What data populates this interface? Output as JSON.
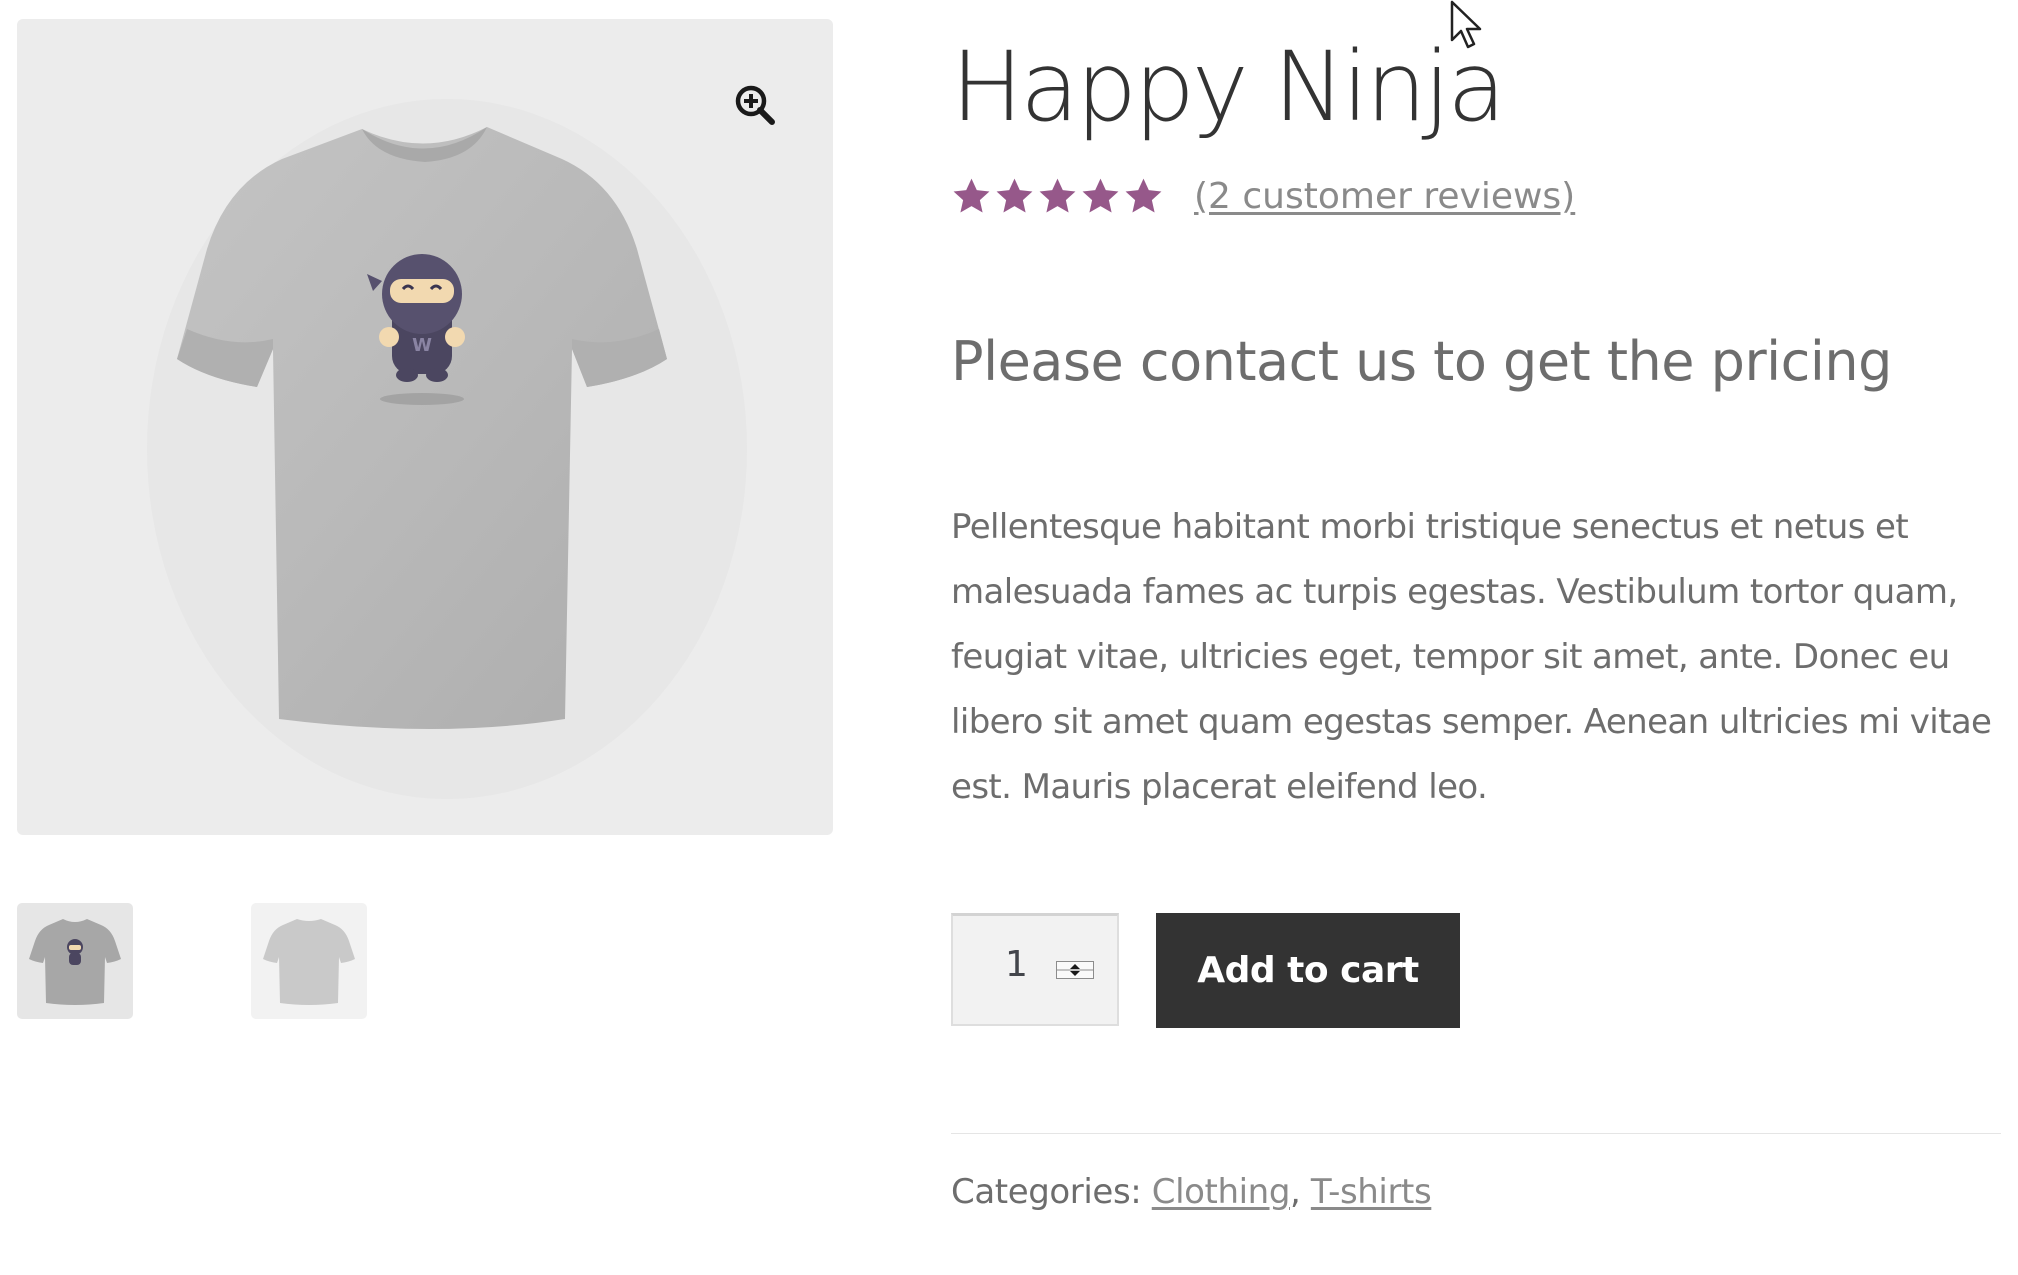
{
  "product": {
    "title": "Happy Ninja",
    "rating": 5,
    "rating_max": 5,
    "reviews_link": "(2 customer reviews)",
    "price_note": "Please contact us to get the pricing",
    "description": "Pellentesque habitant morbi tristique senectus et netus et malesuada fames ac turpis egestas. Vestibulum tortor quam, feugiat vitae, ultricies eget, tempor sit amet, ante. Donec eu libero sit amet quam egestas semper. Aenean ultricies mi vitae est. Mauris placerat eleifend leo."
  },
  "gallery": {
    "zoom_icon": "zoom-in-icon",
    "thumbnails": [
      "tshirt-front-with-ninja",
      "tshirt-back-plain"
    ]
  },
  "cart": {
    "quantity": "1",
    "add_to_cart_label": "Add to cart"
  },
  "meta": {
    "categories_label": "Categories:",
    "separator": ",",
    "categories": [
      "Clothing",
      "T-shirts"
    ]
  },
  "colors": {
    "star": "#96588a",
    "button_bg": "#333333",
    "link": "#8a8a8a"
  }
}
